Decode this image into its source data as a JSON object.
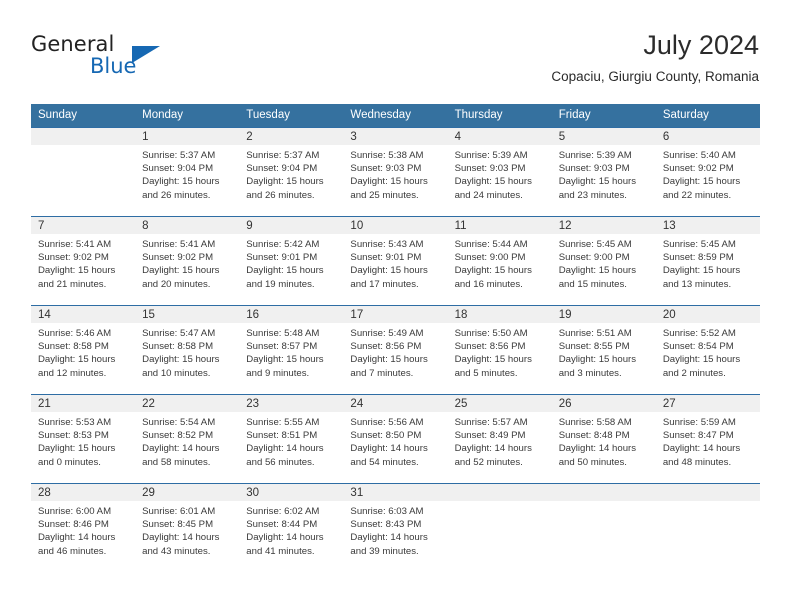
{
  "logo": {
    "word1": "General",
    "word2": "Blue",
    "accent_color": "#1668b3",
    "triangle_icon": "triangle-icon"
  },
  "header": {
    "month_title": "July 2024",
    "location": "Copaciu, Giurgiu County, Romania",
    "header_bg_color": "#35719f",
    "row_divider_color": "#2e6da4"
  },
  "weekday_headers": [
    "Sunday",
    "Monday",
    "Tuesday",
    "Wednesday",
    "Thursday",
    "Friday",
    "Saturday"
  ],
  "weeks": [
    [
      {
        "day": "",
        "lines": []
      },
      {
        "day": "1",
        "lines": [
          "Sunrise: 5:37 AM",
          "Sunset: 9:04 PM",
          "Daylight: 15 hours",
          "and 26 minutes."
        ]
      },
      {
        "day": "2",
        "lines": [
          "Sunrise: 5:37 AM",
          "Sunset: 9:04 PM",
          "Daylight: 15 hours",
          "and 26 minutes."
        ]
      },
      {
        "day": "3",
        "lines": [
          "Sunrise: 5:38 AM",
          "Sunset: 9:03 PM",
          "Daylight: 15 hours",
          "and 25 minutes."
        ]
      },
      {
        "day": "4",
        "lines": [
          "Sunrise: 5:39 AM",
          "Sunset: 9:03 PM",
          "Daylight: 15 hours",
          "and 24 minutes."
        ]
      },
      {
        "day": "5",
        "lines": [
          "Sunrise: 5:39 AM",
          "Sunset: 9:03 PM",
          "Daylight: 15 hours",
          "and 23 minutes."
        ]
      },
      {
        "day": "6",
        "lines": [
          "Sunrise: 5:40 AM",
          "Sunset: 9:02 PM",
          "Daylight: 15 hours",
          "and 22 minutes."
        ]
      }
    ],
    [
      {
        "day": "7",
        "lines": [
          "Sunrise: 5:41 AM",
          "Sunset: 9:02 PM",
          "Daylight: 15 hours",
          "and 21 minutes."
        ]
      },
      {
        "day": "8",
        "lines": [
          "Sunrise: 5:41 AM",
          "Sunset: 9:02 PM",
          "Daylight: 15 hours",
          "and 20 minutes."
        ]
      },
      {
        "day": "9",
        "lines": [
          "Sunrise: 5:42 AM",
          "Sunset: 9:01 PM",
          "Daylight: 15 hours",
          "and 19 minutes."
        ]
      },
      {
        "day": "10",
        "lines": [
          "Sunrise: 5:43 AM",
          "Sunset: 9:01 PM",
          "Daylight: 15 hours",
          "and 17 minutes."
        ]
      },
      {
        "day": "11",
        "lines": [
          "Sunrise: 5:44 AM",
          "Sunset: 9:00 PM",
          "Daylight: 15 hours",
          "and 16 minutes."
        ]
      },
      {
        "day": "12",
        "lines": [
          "Sunrise: 5:45 AM",
          "Sunset: 9:00 PM",
          "Daylight: 15 hours",
          "and 15 minutes."
        ]
      },
      {
        "day": "13",
        "lines": [
          "Sunrise: 5:45 AM",
          "Sunset: 8:59 PM",
          "Daylight: 15 hours",
          "and 13 minutes."
        ]
      }
    ],
    [
      {
        "day": "14",
        "lines": [
          "Sunrise: 5:46 AM",
          "Sunset: 8:58 PM",
          "Daylight: 15 hours",
          "and 12 minutes."
        ]
      },
      {
        "day": "15",
        "lines": [
          "Sunrise: 5:47 AM",
          "Sunset: 8:58 PM",
          "Daylight: 15 hours",
          "and 10 minutes."
        ]
      },
      {
        "day": "16",
        "lines": [
          "Sunrise: 5:48 AM",
          "Sunset: 8:57 PM",
          "Daylight: 15 hours",
          "and 9 minutes."
        ]
      },
      {
        "day": "17",
        "lines": [
          "Sunrise: 5:49 AM",
          "Sunset: 8:56 PM",
          "Daylight: 15 hours",
          "and 7 minutes."
        ]
      },
      {
        "day": "18",
        "lines": [
          "Sunrise: 5:50 AM",
          "Sunset: 8:56 PM",
          "Daylight: 15 hours",
          "and 5 minutes."
        ]
      },
      {
        "day": "19",
        "lines": [
          "Sunrise: 5:51 AM",
          "Sunset: 8:55 PM",
          "Daylight: 15 hours",
          "and 3 minutes."
        ]
      },
      {
        "day": "20",
        "lines": [
          "Sunrise: 5:52 AM",
          "Sunset: 8:54 PM",
          "Daylight: 15 hours",
          "and 2 minutes."
        ]
      }
    ],
    [
      {
        "day": "21",
        "lines": [
          "Sunrise: 5:53 AM",
          "Sunset: 8:53 PM",
          "Daylight: 15 hours",
          "and 0 minutes."
        ]
      },
      {
        "day": "22",
        "lines": [
          "Sunrise: 5:54 AM",
          "Sunset: 8:52 PM",
          "Daylight: 14 hours",
          "and 58 minutes."
        ]
      },
      {
        "day": "23",
        "lines": [
          "Sunrise: 5:55 AM",
          "Sunset: 8:51 PM",
          "Daylight: 14 hours",
          "and 56 minutes."
        ]
      },
      {
        "day": "24",
        "lines": [
          "Sunrise: 5:56 AM",
          "Sunset: 8:50 PM",
          "Daylight: 14 hours",
          "and 54 minutes."
        ]
      },
      {
        "day": "25",
        "lines": [
          "Sunrise: 5:57 AM",
          "Sunset: 8:49 PM",
          "Daylight: 14 hours",
          "and 52 minutes."
        ]
      },
      {
        "day": "26",
        "lines": [
          "Sunrise: 5:58 AM",
          "Sunset: 8:48 PM",
          "Daylight: 14 hours",
          "and 50 minutes."
        ]
      },
      {
        "day": "27",
        "lines": [
          "Sunrise: 5:59 AM",
          "Sunset: 8:47 PM",
          "Daylight: 14 hours",
          "and 48 minutes."
        ]
      }
    ],
    [
      {
        "day": "28",
        "lines": [
          "Sunrise: 6:00 AM",
          "Sunset: 8:46 PM",
          "Daylight: 14 hours",
          "and 46 minutes."
        ]
      },
      {
        "day": "29",
        "lines": [
          "Sunrise: 6:01 AM",
          "Sunset: 8:45 PM",
          "Daylight: 14 hours",
          "and 43 minutes."
        ]
      },
      {
        "day": "30",
        "lines": [
          "Sunrise: 6:02 AM",
          "Sunset: 8:44 PM",
          "Daylight: 14 hours",
          "and 41 minutes."
        ]
      },
      {
        "day": "31",
        "lines": [
          "Sunrise: 6:03 AM",
          "Sunset: 8:43 PM",
          "Daylight: 14 hours",
          "and 39 minutes."
        ]
      },
      {
        "day": "",
        "lines": []
      },
      {
        "day": "",
        "lines": []
      },
      {
        "day": "",
        "lines": []
      }
    ]
  ]
}
